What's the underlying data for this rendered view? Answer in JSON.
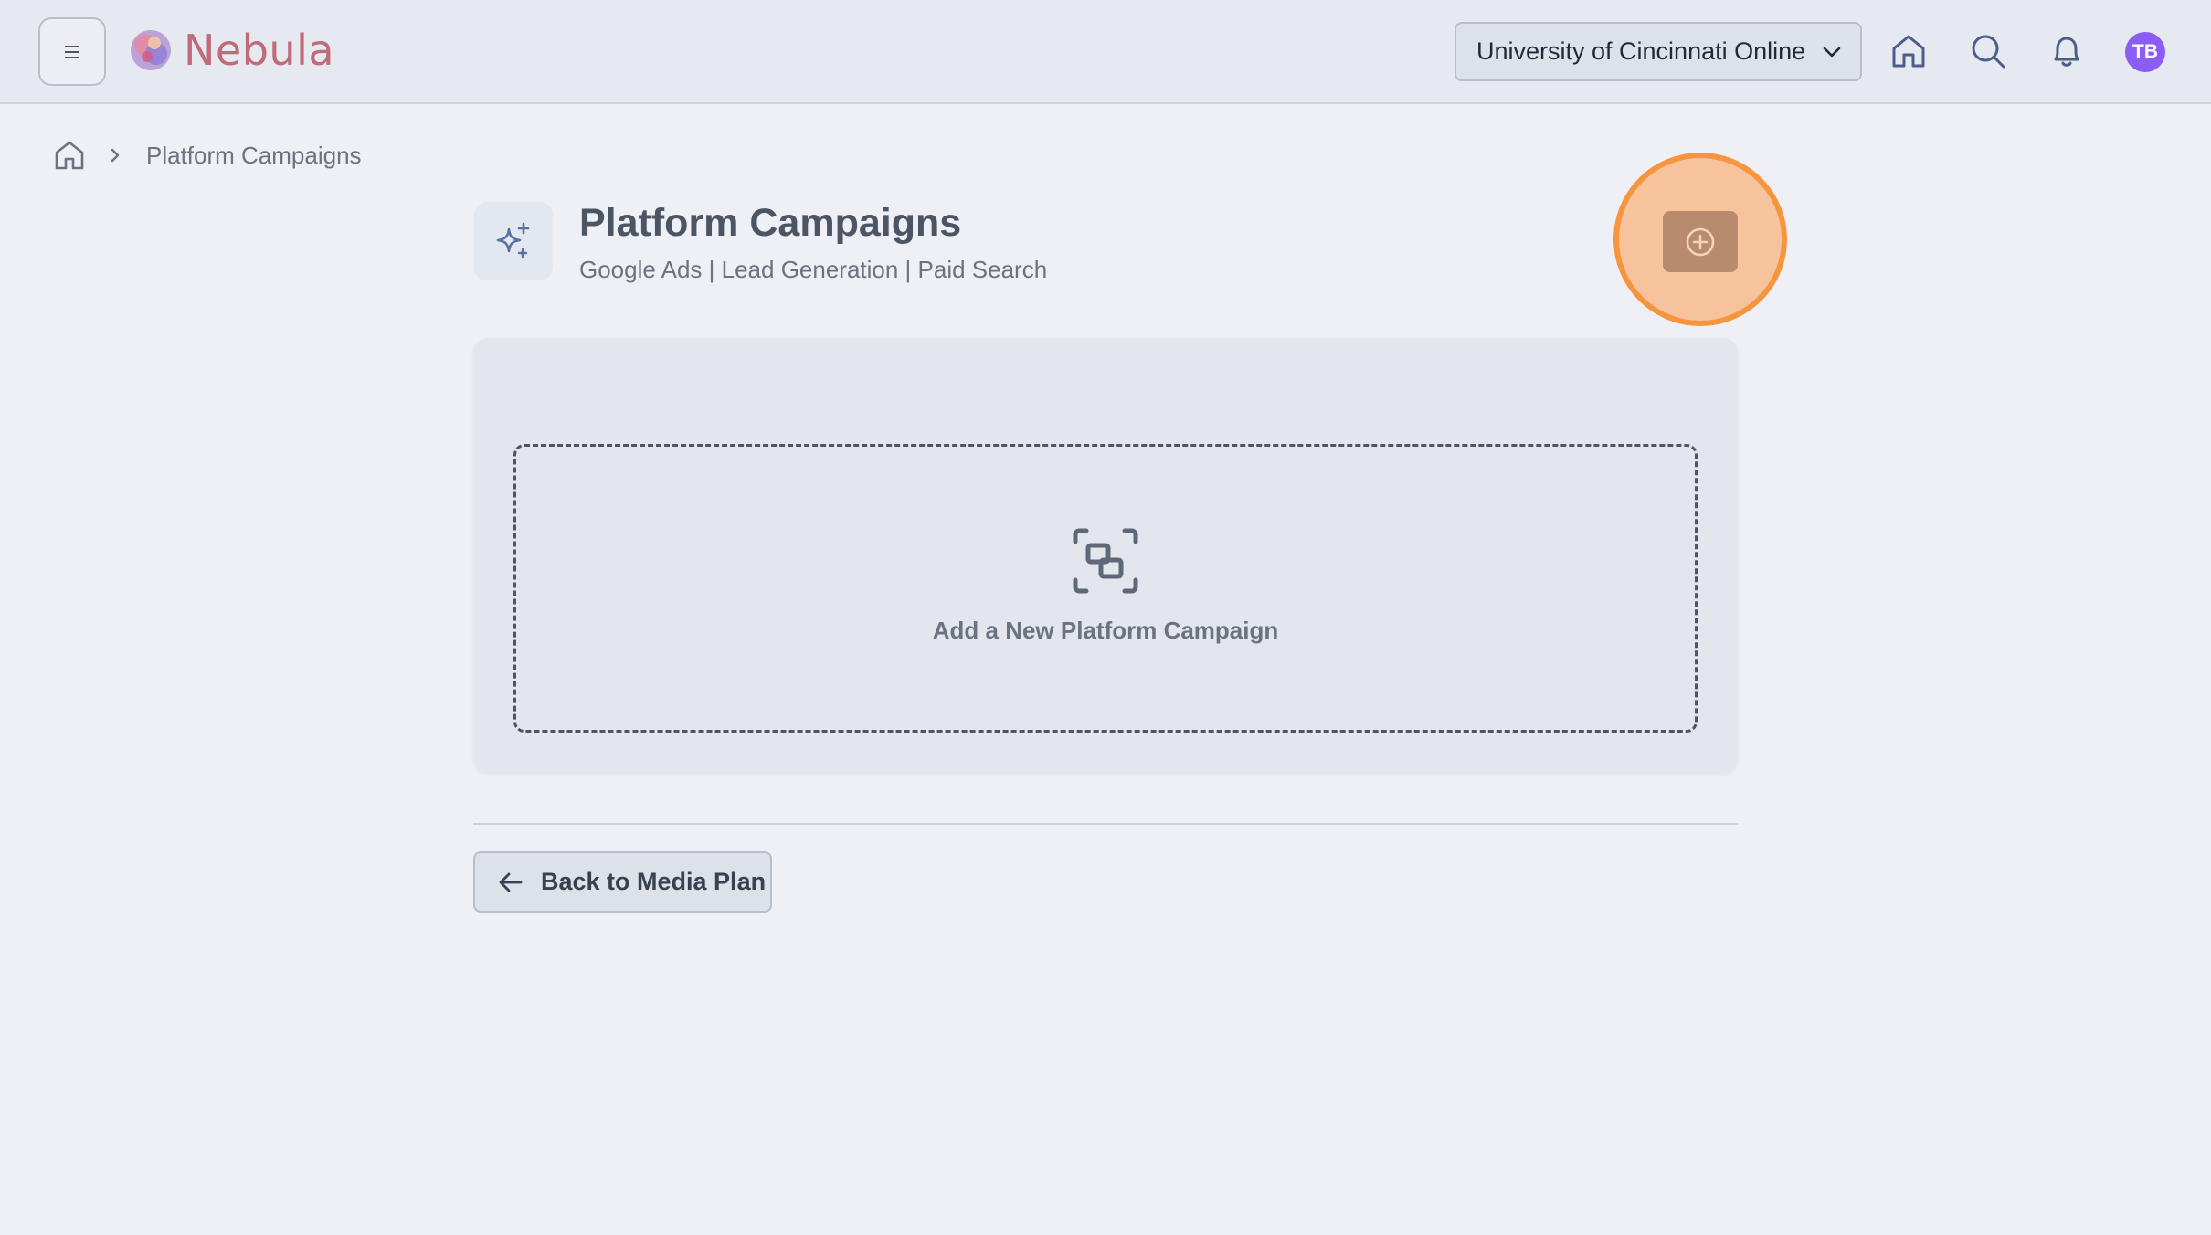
{
  "header": {
    "app_name": "Nebula",
    "org_selector": "University of Cincinnati Online",
    "avatar_initials": "TB",
    "icons": [
      "menu-icon",
      "home-icon",
      "search-icon",
      "bell-icon"
    ]
  },
  "breadcrumb": {
    "items": [
      "Platform Campaigns"
    ]
  },
  "page": {
    "title": "Platform Campaigns",
    "subtitle": "Google Ads | Lead Generation | Paid Search",
    "icon": "sparkles-icon"
  },
  "add_button": {
    "icon": "plus-circle-icon",
    "highlighted": true
  },
  "dropzone": {
    "label": "Add a New Platform Campaign",
    "icon": "group-icon"
  },
  "back_button": {
    "label": "Back to Media Plan",
    "icon": "arrow-left-icon"
  },
  "colors": {
    "accent_highlight": "#f7953f",
    "avatar_bg": "#8b5cf6",
    "logo_text": "#c06a7a"
  }
}
